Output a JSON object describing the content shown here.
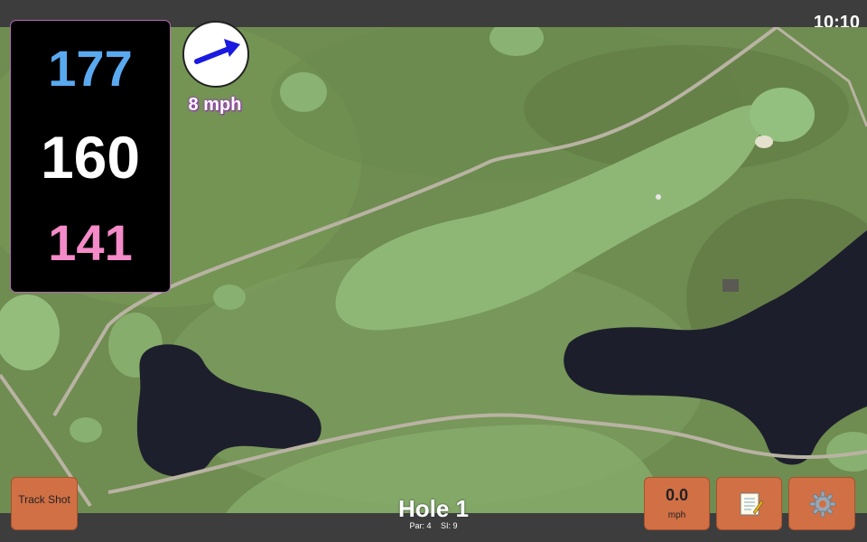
{
  "status_bar": {
    "time": "10:10"
  },
  "distances": {
    "back": "177",
    "middle": "160",
    "front": "141"
  },
  "wind": {
    "speed_label": "8 mph",
    "icon": "wind-arrow-icon"
  },
  "buttons": {
    "track_shot": "Track Shot",
    "speed_value": "0.0",
    "speed_unit": "mph",
    "notes_icon": "notepad-icon",
    "settings_icon": "gear-icon"
  },
  "hole": {
    "title": "Hole 1",
    "par": "Par: 4",
    "stroke_index": "SI: 9"
  },
  "colors": {
    "back_distance": "#5aa9f0",
    "middle_distance": "#ffffff",
    "front_distance": "#f48ac8",
    "button_bg": "#d17045",
    "fairway": "#8fb874",
    "water": "#1d1f2c",
    "rough": "#6d8b4f"
  }
}
